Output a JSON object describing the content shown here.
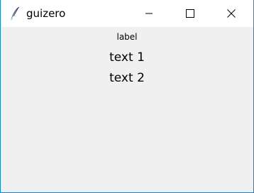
{
  "window": {
    "title": "guizero",
    "icon": "feather-icon"
  },
  "titlebar_buttons": {
    "minimize_icon": "minimize-icon",
    "maximize_icon": "maximize-icon",
    "close_icon": "close-icon"
  },
  "content": {
    "label": "label",
    "text_1": "text 1",
    "text_2": "text 2"
  },
  "colors": {
    "window_border": "#1883d7",
    "titlebar": "#ffffff",
    "content_background": "#f0f0f0"
  }
}
